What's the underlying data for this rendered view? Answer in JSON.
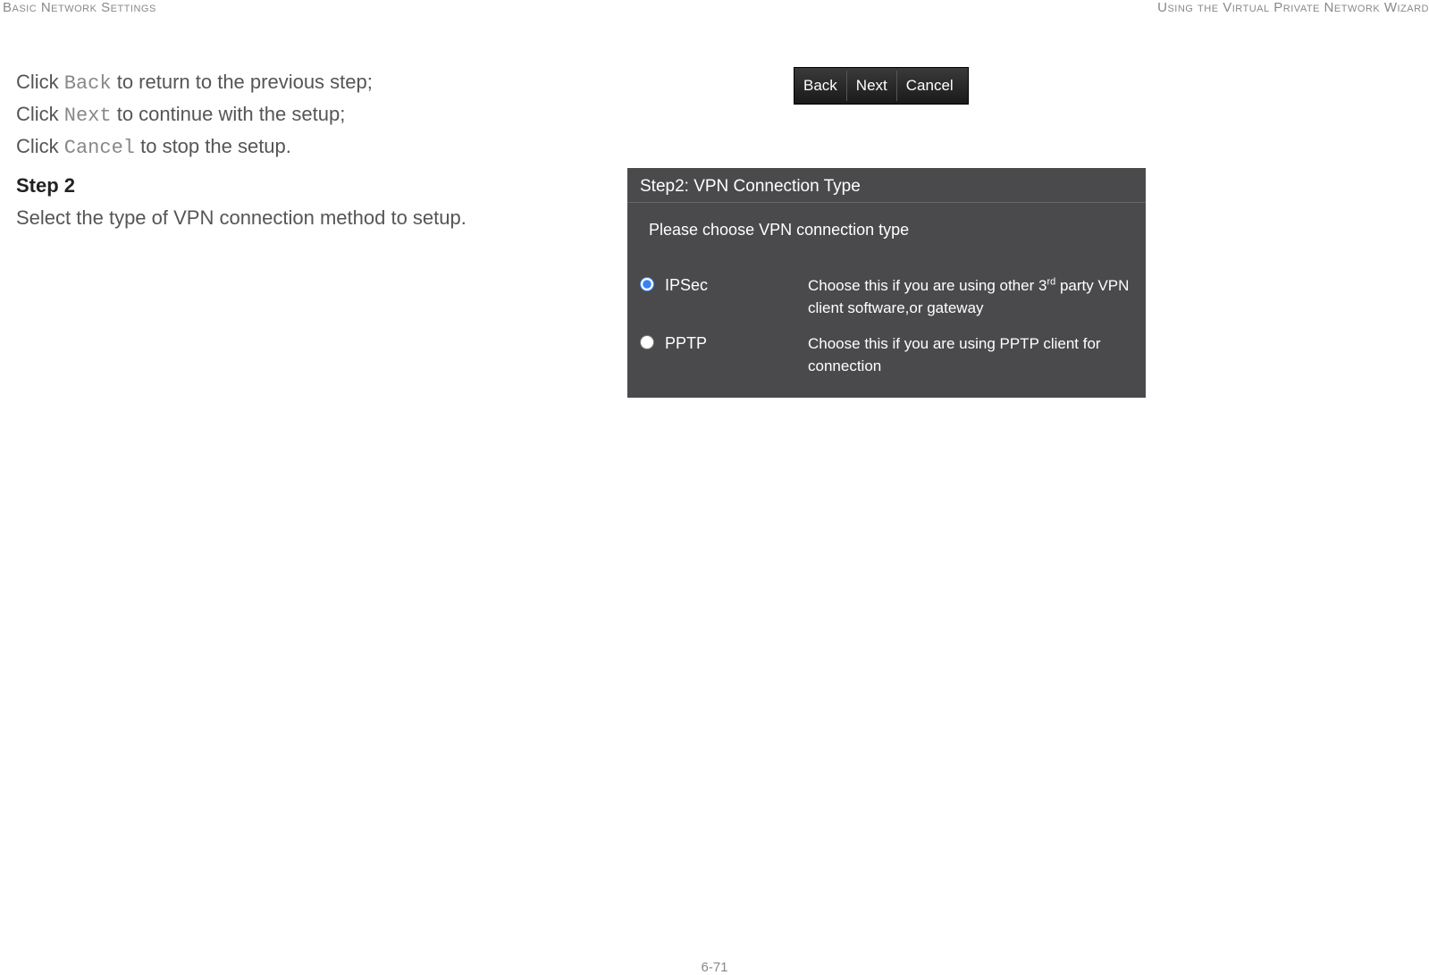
{
  "header": {
    "left": "Basic Network Settings",
    "right": "Using the Virtual Private Network Wizard"
  },
  "instructions": {
    "line1_pre": "Click ",
    "line1_mono": "Back",
    "line1_post": " to return to the previous step;",
    "line2_pre": "Click ",
    "line2_mono": "Next",
    "line2_post": " to continue with the setup;",
    "line3_pre": "Click ",
    "line3_mono": "Cancel",
    "line3_post": " to stop the setup."
  },
  "step": {
    "heading": "Step 2",
    "text": "Select the type of VPN connection method to setup."
  },
  "nav_buttons": {
    "back": "Back",
    "next": "Next",
    "cancel": "Cancel"
  },
  "vpn_panel": {
    "title": "Step2: VPN Connection Type",
    "subtitle": "Please choose VPN connection type",
    "options": [
      {
        "value": "ipsec",
        "label": "IPSec",
        "desc_pre": "Choose this if you are using other 3",
        "desc_sup": "rd",
        "desc_post": " party VPN client software,or gateway",
        "selected": true
      },
      {
        "value": "pptp",
        "label": "PPTP",
        "desc_pre": "Choose this if you are using PPTP client for connection",
        "desc_sup": "",
        "desc_post": "",
        "selected": false
      }
    ]
  },
  "footer": {
    "page_number": "6-71"
  }
}
